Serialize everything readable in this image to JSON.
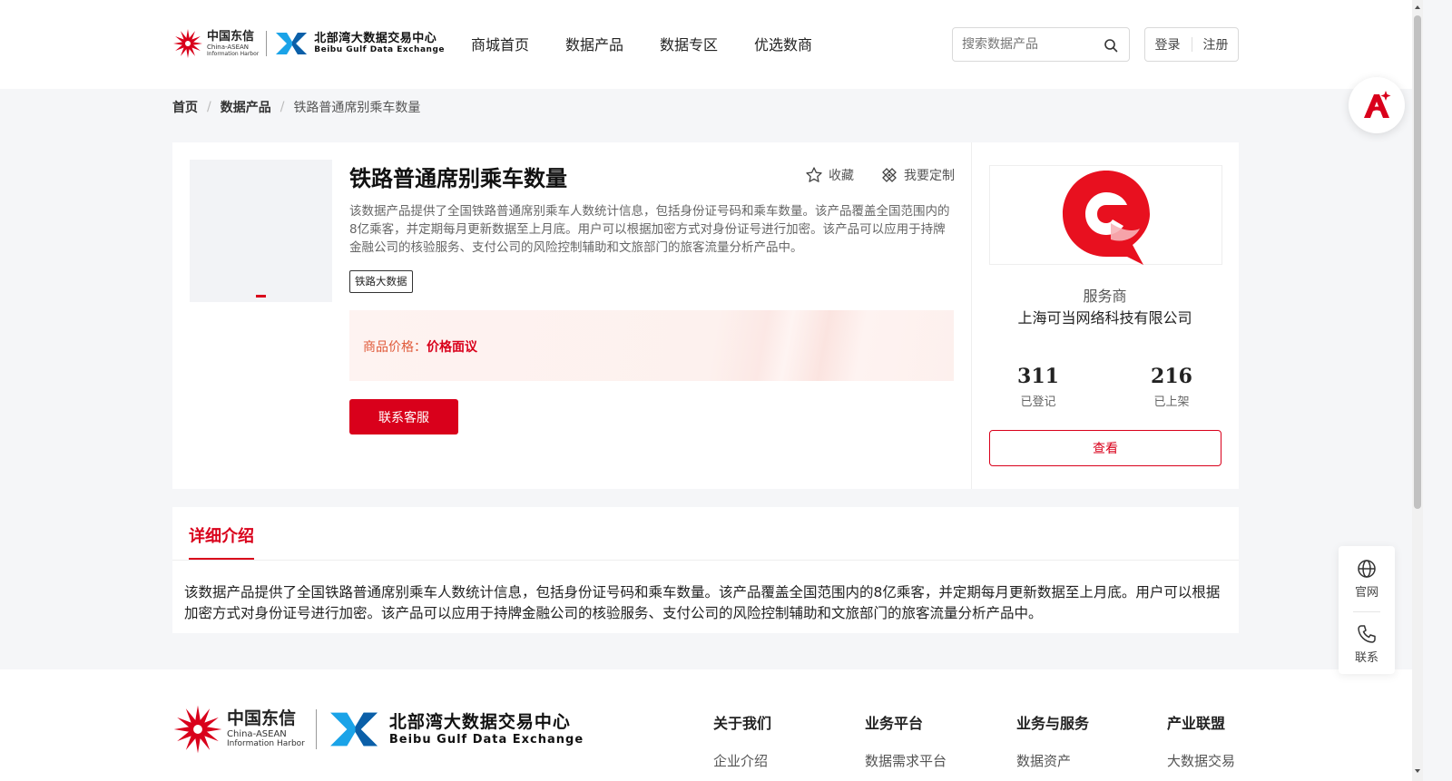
{
  "header": {
    "logo_ct_cn": "中国东信",
    "logo_ct_en1": "China-ASEAN",
    "logo_ct_en2": "Information Harbor",
    "logo_bb_cn": "北部湾大数据交易中心",
    "logo_bb_en": "Beibu Gulf Data Exchange",
    "nav": [
      "商城首页",
      "数据产品",
      "数据专区",
      "优选数商"
    ],
    "search_placeholder": "搜索数据产品",
    "login": "登录",
    "register": "注册"
  },
  "breadcrumb": [
    "首页",
    "数据产品",
    "铁路普通席别乘车数量"
  ],
  "product": {
    "title": "铁路普通席别乘车数量",
    "favorite": "收藏",
    "customize": "我要定制",
    "description": "该数据产品提供了全国铁路普通席别乘车人数统计信息，包括身份证号码和乘车数量。该产品覆盖全国范围内的8亿乘客，并定期每月更新数据至上月底。用户可以根据加密方式对身份证号进行加密。该产品可以应用于持牌金融公司的核验服务、支付公司的风险控制辅助和文旅部门的旅客流量分析产品中。",
    "tag": "铁路大数据",
    "price_label": "商品价格：",
    "price_value": "价格面议",
    "contact_button": "联系客服"
  },
  "provider": {
    "type": "服务商",
    "name": "上海可当网络科技有限公司",
    "registered_count": "311",
    "registered_label": "已登记",
    "listed_count": "216",
    "listed_label": "已上架",
    "view_button": "查看"
  },
  "detail": {
    "tab": "详细介绍",
    "text": "该数据产品提供了全国铁路普通席别乘车人数统计信息，包括身份证号码和乘车数量。该产品覆盖全国范围内的8亿乘客，并定期每月更新数据至上月底。用户可以根据加密方式对身份证号进行加密。该产品可以应用于持牌金融公司的核验服务、支付公司的风险控制辅助和文旅部门的旅客流量分析产品中。"
  },
  "footer": {
    "columns": [
      {
        "head": "关于我们",
        "link": "企业介绍"
      },
      {
        "head": "业务平台",
        "link": "数据需求平台"
      },
      {
        "head": "业务与服务",
        "link": "数据资产"
      },
      {
        "head": "产业联盟",
        "link": "大数据交易"
      }
    ]
  },
  "floating": {
    "website": "官网",
    "contact": "联系"
  },
  "colors": {
    "brand_red": "#d9001b",
    "price_orange": "#e05a3a",
    "logo_blue": "#1aa3e8"
  }
}
